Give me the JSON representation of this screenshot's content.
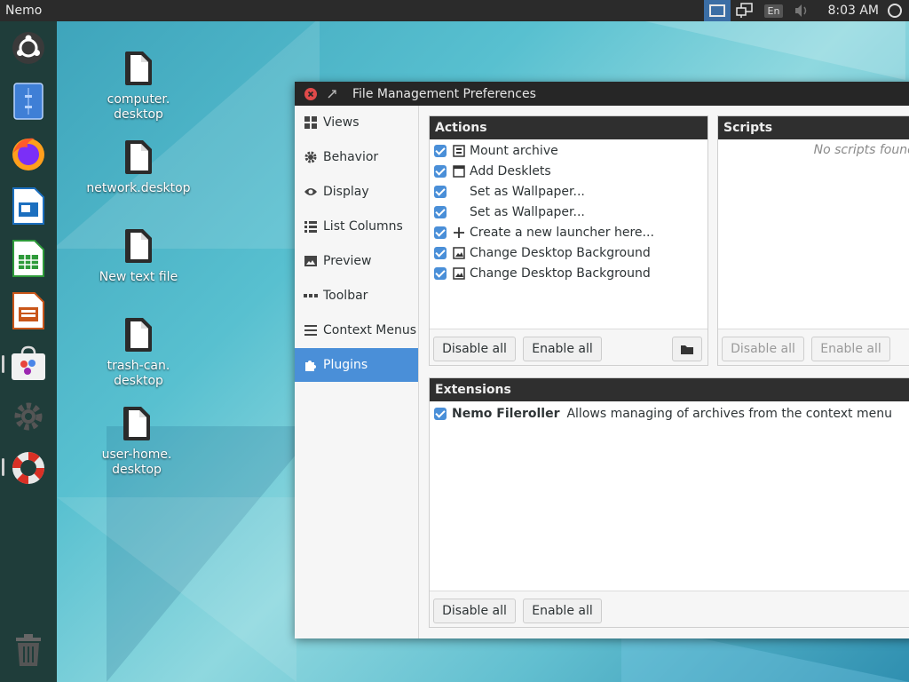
{
  "top_panel": {
    "app_name": "Nemo",
    "lang": "En",
    "clock": "8:03 AM"
  },
  "launcher": {
    "items": [
      {
        "name": "ubuntu-icon"
      },
      {
        "name": "files-icon"
      },
      {
        "name": "firefox-icon"
      },
      {
        "name": "writer-icon"
      },
      {
        "name": "calc-icon"
      },
      {
        "name": "impress-icon"
      },
      {
        "name": "software-center-icon"
      },
      {
        "name": "settings-gear-icon"
      },
      {
        "name": "help-lifebuoy-icon"
      }
    ],
    "trash": "trash-icon"
  },
  "desktop": {
    "icons": [
      {
        "label": "computer.\ndesktop"
      },
      {
        "label": "network.desktop"
      },
      {
        "label": "New text file"
      },
      {
        "label": "trash-can.\ndesktop"
      },
      {
        "label": "user-home.\ndesktop"
      }
    ]
  },
  "window": {
    "title": "File Management Preferences",
    "sidebar": [
      {
        "label": "Views",
        "icon": "grid-icon"
      },
      {
        "label": "Behavior",
        "icon": "gear-icon"
      },
      {
        "label": "Display",
        "icon": "eye-icon"
      },
      {
        "label": "List Columns",
        "icon": "list-icon"
      },
      {
        "label": "Preview",
        "icon": "image-icon"
      },
      {
        "label": "Toolbar",
        "icon": "dots-icon"
      },
      {
        "label": "Context Menus",
        "icon": "menu-icon"
      },
      {
        "label": "Plugins",
        "icon": "puzzle-icon",
        "active": true
      }
    ],
    "actions": {
      "header": "Actions",
      "items": [
        {
          "label": "Mount archive",
          "icon": "archive-icon"
        },
        {
          "label": "Add Desklets",
          "icon": "window-icon"
        },
        {
          "label": "Set as Wallpaper...",
          "icon": ""
        },
        {
          "label": "Set as Wallpaper...",
          "icon": ""
        },
        {
          "label": "Create a new launcher here...",
          "icon": "plus-icon"
        },
        {
          "label": "Change Desktop Background",
          "icon": "picture-icon"
        },
        {
          "label": "Change Desktop Background",
          "icon": "picture-icon"
        }
      ],
      "disable_all": "Disable all",
      "enable_all": "Enable all"
    },
    "scripts": {
      "header": "Scripts",
      "empty": "No scripts found",
      "disable_all": "Disable all",
      "enable_all": "Enable all"
    },
    "extensions": {
      "header": "Extensions",
      "items": [
        {
          "name": "Nemo Fileroller",
          "description": "Allows managing of archives from the context menu"
        }
      ],
      "disable_all": "Disable all",
      "enable_all": "Enable all"
    }
  }
}
